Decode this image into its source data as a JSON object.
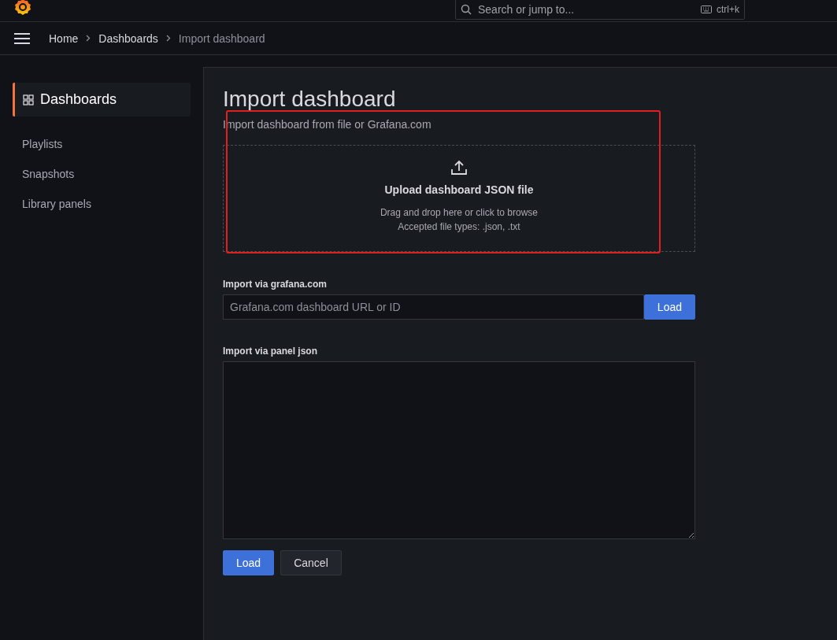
{
  "top_bar": {
    "search": {
      "placeholder": "Search or jump to...",
      "shortcut": "ctrl+k"
    }
  },
  "breadcrumbs": [
    {
      "label": "Home",
      "current": false
    },
    {
      "label": "Dashboards",
      "current": false
    },
    {
      "label": "Import dashboard",
      "current": true
    }
  ],
  "sidebar": {
    "items": [
      {
        "label": "Dashboards",
        "selected": true
      },
      {
        "label": "Playlists",
        "selected": false
      },
      {
        "label": "Snapshots",
        "selected": false
      },
      {
        "label": "Library panels",
        "selected": false
      }
    ]
  },
  "page": {
    "title": "Import dashboard",
    "subtitle": "Import dashboard from file or Grafana.com",
    "upload": {
      "title": "Upload dashboard JSON file",
      "hint": "Drag and drop here or click to browse",
      "types": "Accepted file types: .json, .txt"
    },
    "annotation": {
      "kind": "frame"
    },
    "grafana_import": {
      "label": "Import via grafana.com",
      "placeholder": "Grafana.com dashboard URL or ID",
      "button": "Load"
    },
    "panel_json": {
      "label": "Import via panel json"
    },
    "buttons": [
      {
        "label": "Load",
        "kind": "primary"
      },
      {
        "label": "Cancel",
        "kind": "secondary"
      }
    ]
  }
}
